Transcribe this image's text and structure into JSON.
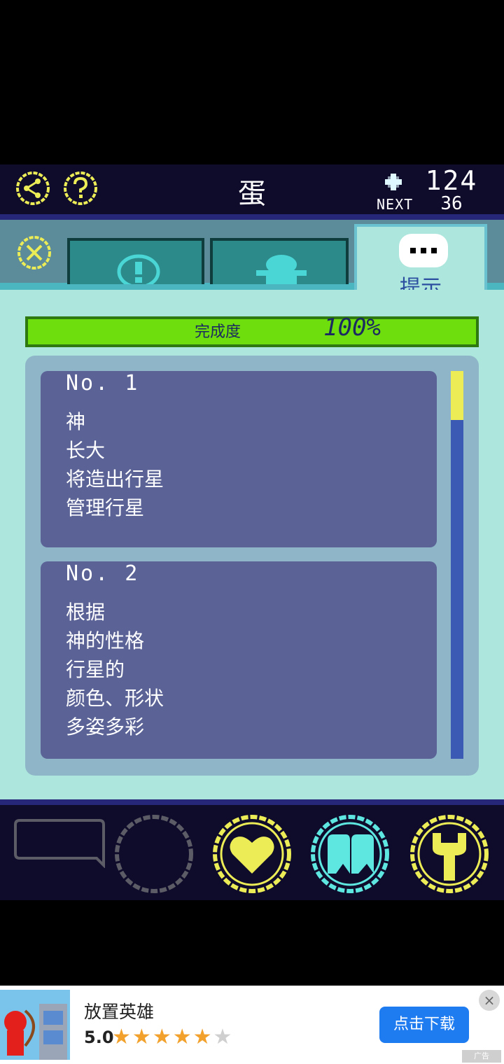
{
  "header": {
    "title": "蛋",
    "points": "124",
    "next_label": "NEXT",
    "next_value": "36"
  },
  "tabs": [
    {
      "name": "info",
      "icon": "exclamation-icon"
    },
    {
      "name": "character",
      "icon": "silhouette-icon"
    },
    {
      "name": "hints",
      "icon": "speech-bubble-icon",
      "label": "提示",
      "active": true
    }
  ],
  "progress": {
    "label": "完成度",
    "value": "100%",
    "fraction": 1.0
  },
  "hints": [
    {
      "no": "No. 1",
      "lines": [
        "神",
        "长大",
        "将造出行星",
        "管理行星"
      ]
    },
    {
      "no": "No. 2",
      "lines": [
        "根据",
        "神的性格",
        "行星的",
        "颜色、形状",
        "多姿多彩"
      ]
    }
  ],
  "scroll": {
    "position_fraction": 0.0
  },
  "bottom_nav": [
    "chat-bubble-icon",
    "circle-icon",
    "heart-icon",
    "gallery-icon",
    "wrench-icon"
  ],
  "ad": {
    "title": "放置英雄",
    "rating": "5.0",
    "stars_filled": 5,
    "stars_total": 6,
    "cta": "点击下载",
    "close": "×",
    "tag": "广告"
  },
  "colors": {
    "accent_yellow": "#ecec56",
    "accent_cyan": "#5ee6e0",
    "progress_green": "#6ede0c",
    "card_bg": "#5a6296",
    "cta_blue": "#1f7cf0"
  }
}
